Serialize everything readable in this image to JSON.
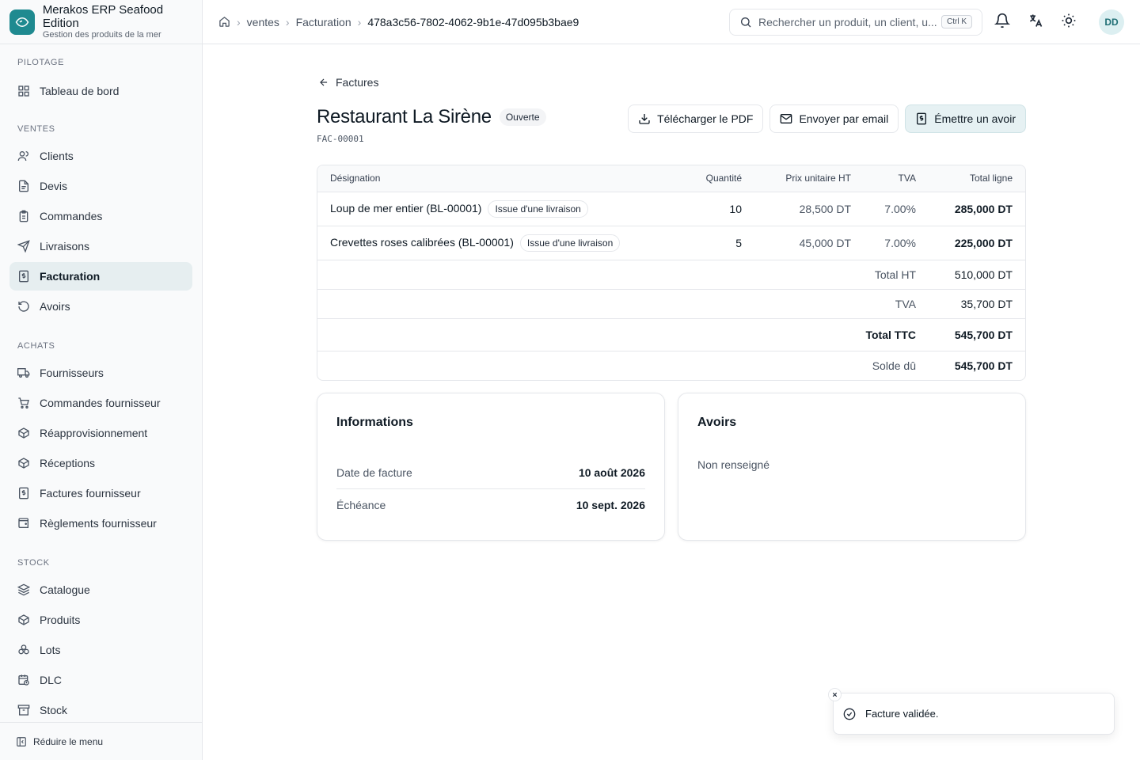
{
  "brand": {
    "title": "Merakos ERP Seafood Edition",
    "subtitle": "Gestion des produits de la mer",
    "accent": "#1f8a90"
  },
  "sidebar": {
    "sections": [
      {
        "label": "PILOTAGE",
        "items": [
          {
            "label": "Tableau de bord",
            "icon": "dashboard-icon"
          }
        ]
      },
      {
        "label": "VENTES",
        "items": [
          {
            "label": "Clients",
            "icon": "users-icon"
          },
          {
            "label": "Devis",
            "icon": "file-text-icon"
          },
          {
            "label": "Commandes",
            "icon": "clipboard-icon"
          },
          {
            "label": "Livraisons",
            "icon": "send-icon"
          },
          {
            "label": "Facturation",
            "icon": "invoice-icon",
            "active": true
          },
          {
            "label": "Avoirs",
            "icon": "rotate-ccw-icon"
          }
        ]
      },
      {
        "label": "ACHATS",
        "items": [
          {
            "label": "Fournisseurs",
            "icon": "truck-icon"
          },
          {
            "label": "Commandes fournisseur",
            "icon": "cart-icon"
          },
          {
            "label": "Réapprovisionnement",
            "icon": "package-icon"
          },
          {
            "label": "Réceptions",
            "icon": "package-check-icon"
          },
          {
            "label": "Factures fournisseur",
            "icon": "receipt-icon"
          },
          {
            "label": "Règlements fournisseur",
            "icon": "wallet-icon"
          }
        ]
      },
      {
        "label": "STOCK",
        "items": [
          {
            "label": "Catalogue",
            "icon": "layers-icon"
          },
          {
            "label": "Produits",
            "icon": "box-icon"
          },
          {
            "label": "Lots",
            "icon": "boxes-icon"
          },
          {
            "label": "DLC",
            "icon": "calendar-clock-icon"
          },
          {
            "label": "Stock",
            "icon": "archive-icon"
          }
        ]
      }
    ],
    "collapse_label": "Réduire le menu"
  },
  "breadcrumb": {
    "items": [
      "ventes",
      "Facturation"
    ],
    "current": "478a3c56-7802-4062-9b1e-47d095b3bae9"
  },
  "search": {
    "placeholder": "Rechercher un produit, un client, u...",
    "shortcut": "Ctrl K"
  },
  "user": {
    "initials": "DD"
  },
  "invoice": {
    "back_label": "Factures",
    "title": "Restaurant La Sirène",
    "status": "Ouverte",
    "code": "FAC-00001",
    "actions": {
      "pdf": "Télécharger le PDF",
      "email": "Envoyer par email",
      "credit": "Émettre un avoir"
    },
    "columns": [
      "Désignation",
      "Quantité",
      "Prix unitaire HT",
      "TVA",
      "Total ligne"
    ],
    "lines": [
      {
        "designation": "Loup de mer entier (BL-00001)",
        "tag": "Issue d'une livraison",
        "qty": "10",
        "unit_price": "28,500 DT",
        "vat": "7.00%",
        "total": "285,000 DT"
      },
      {
        "designation": "Crevettes roses calibrées (BL-00001)",
        "tag": "Issue d'une livraison",
        "qty": "5",
        "unit_price": "45,000 DT",
        "vat": "7.00%",
        "total": "225,000 DT"
      }
    ],
    "totals": {
      "ht_label": "Total HT",
      "ht": "510,000 DT",
      "vat_label": "TVA",
      "vat": "35,700 DT",
      "ttc_label": "Total TTC",
      "ttc": "545,700 DT",
      "due_label": "Solde dû",
      "due": "545,700 DT"
    }
  },
  "info_card": {
    "title": "Informations",
    "date_label": "Date de facture",
    "date": "10 août 2026",
    "due_label": "Échéance",
    "due": "10 sept. 2026"
  },
  "credits_card": {
    "title": "Avoirs",
    "empty": "Non renseigné"
  },
  "toast": {
    "message": "Facture validée."
  }
}
